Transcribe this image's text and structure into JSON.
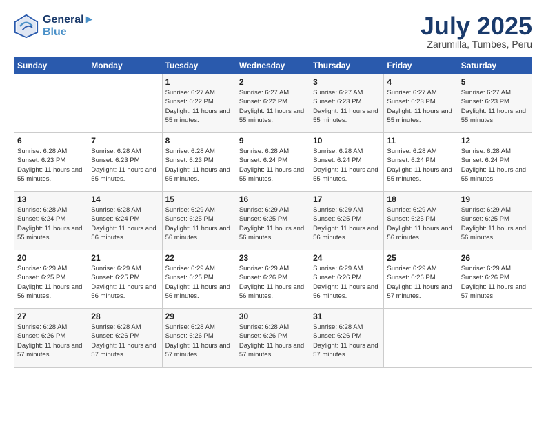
{
  "header": {
    "logo_line1": "General",
    "logo_line2": "Blue",
    "month": "July 2025",
    "location": "Zarumilla, Tumbes, Peru"
  },
  "weekdays": [
    "Sunday",
    "Monday",
    "Tuesday",
    "Wednesday",
    "Thursday",
    "Friday",
    "Saturday"
  ],
  "weeks": [
    [
      {
        "day": "",
        "sunrise": "",
        "sunset": "",
        "daylight": ""
      },
      {
        "day": "",
        "sunrise": "",
        "sunset": "",
        "daylight": ""
      },
      {
        "day": "1",
        "sunrise": "Sunrise: 6:27 AM",
        "sunset": "Sunset: 6:22 PM",
        "daylight": "Daylight: 11 hours and 55 minutes."
      },
      {
        "day": "2",
        "sunrise": "Sunrise: 6:27 AM",
        "sunset": "Sunset: 6:22 PM",
        "daylight": "Daylight: 11 hours and 55 minutes."
      },
      {
        "day": "3",
        "sunrise": "Sunrise: 6:27 AM",
        "sunset": "Sunset: 6:23 PM",
        "daylight": "Daylight: 11 hours and 55 minutes."
      },
      {
        "day": "4",
        "sunrise": "Sunrise: 6:27 AM",
        "sunset": "Sunset: 6:23 PM",
        "daylight": "Daylight: 11 hours and 55 minutes."
      },
      {
        "day": "5",
        "sunrise": "Sunrise: 6:27 AM",
        "sunset": "Sunset: 6:23 PM",
        "daylight": "Daylight: 11 hours and 55 minutes."
      }
    ],
    [
      {
        "day": "6",
        "sunrise": "Sunrise: 6:28 AM",
        "sunset": "Sunset: 6:23 PM",
        "daylight": "Daylight: 11 hours and 55 minutes."
      },
      {
        "day": "7",
        "sunrise": "Sunrise: 6:28 AM",
        "sunset": "Sunset: 6:23 PM",
        "daylight": "Daylight: 11 hours and 55 minutes."
      },
      {
        "day": "8",
        "sunrise": "Sunrise: 6:28 AM",
        "sunset": "Sunset: 6:23 PM",
        "daylight": "Daylight: 11 hours and 55 minutes."
      },
      {
        "day": "9",
        "sunrise": "Sunrise: 6:28 AM",
        "sunset": "Sunset: 6:24 PM",
        "daylight": "Daylight: 11 hours and 55 minutes."
      },
      {
        "day": "10",
        "sunrise": "Sunrise: 6:28 AM",
        "sunset": "Sunset: 6:24 PM",
        "daylight": "Daylight: 11 hours and 55 minutes."
      },
      {
        "day": "11",
        "sunrise": "Sunrise: 6:28 AM",
        "sunset": "Sunset: 6:24 PM",
        "daylight": "Daylight: 11 hours and 55 minutes."
      },
      {
        "day": "12",
        "sunrise": "Sunrise: 6:28 AM",
        "sunset": "Sunset: 6:24 PM",
        "daylight": "Daylight: 11 hours and 55 minutes."
      }
    ],
    [
      {
        "day": "13",
        "sunrise": "Sunrise: 6:28 AM",
        "sunset": "Sunset: 6:24 PM",
        "daylight": "Daylight: 11 hours and 55 minutes."
      },
      {
        "day": "14",
        "sunrise": "Sunrise: 6:28 AM",
        "sunset": "Sunset: 6:24 PM",
        "daylight": "Daylight: 11 hours and 56 minutes."
      },
      {
        "day": "15",
        "sunrise": "Sunrise: 6:29 AM",
        "sunset": "Sunset: 6:25 PM",
        "daylight": "Daylight: 11 hours and 56 minutes."
      },
      {
        "day": "16",
        "sunrise": "Sunrise: 6:29 AM",
        "sunset": "Sunset: 6:25 PM",
        "daylight": "Daylight: 11 hours and 56 minutes."
      },
      {
        "day": "17",
        "sunrise": "Sunrise: 6:29 AM",
        "sunset": "Sunset: 6:25 PM",
        "daylight": "Daylight: 11 hours and 56 minutes."
      },
      {
        "day": "18",
        "sunrise": "Sunrise: 6:29 AM",
        "sunset": "Sunset: 6:25 PM",
        "daylight": "Daylight: 11 hours and 56 minutes."
      },
      {
        "day": "19",
        "sunrise": "Sunrise: 6:29 AM",
        "sunset": "Sunset: 6:25 PM",
        "daylight": "Daylight: 11 hours and 56 minutes."
      }
    ],
    [
      {
        "day": "20",
        "sunrise": "Sunrise: 6:29 AM",
        "sunset": "Sunset: 6:25 PM",
        "daylight": "Daylight: 11 hours and 56 minutes."
      },
      {
        "day": "21",
        "sunrise": "Sunrise: 6:29 AM",
        "sunset": "Sunset: 6:25 PM",
        "daylight": "Daylight: 11 hours and 56 minutes."
      },
      {
        "day": "22",
        "sunrise": "Sunrise: 6:29 AM",
        "sunset": "Sunset: 6:25 PM",
        "daylight": "Daylight: 11 hours and 56 minutes."
      },
      {
        "day": "23",
        "sunrise": "Sunrise: 6:29 AM",
        "sunset": "Sunset: 6:26 PM",
        "daylight": "Daylight: 11 hours and 56 minutes."
      },
      {
        "day": "24",
        "sunrise": "Sunrise: 6:29 AM",
        "sunset": "Sunset: 6:26 PM",
        "daylight": "Daylight: 11 hours and 56 minutes."
      },
      {
        "day": "25",
        "sunrise": "Sunrise: 6:29 AM",
        "sunset": "Sunset: 6:26 PM",
        "daylight": "Daylight: 11 hours and 57 minutes."
      },
      {
        "day": "26",
        "sunrise": "Sunrise: 6:29 AM",
        "sunset": "Sunset: 6:26 PM",
        "daylight": "Daylight: 11 hours and 57 minutes."
      }
    ],
    [
      {
        "day": "27",
        "sunrise": "Sunrise: 6:28 AM",
        "sunset": "Sunset: 6:26 PM",
        "daylight": "Daylight: 11 hours and 57 minutes."
      },
      {
        "day": "28",
        "sunrise": "Sunrise: 6:28 AM",
        "sunset": "Sunset: 6:26 PM",
        "daylight": "Daylight: 11 hours and 57 minutes."
      },
      {
        "day": "29",
        "sunrise": "Sunrise: 6:28 AM",
        "sunset": "Sunset: 6:26 PM",
        "daylight": "Daylight: 11 hours and 57 minutes."
      },
      {
        "day": "30",
        "sunrise": "Sunrise: 6:28 AM",
        "sunset": "Sunset: 6:26 PM",
        "daylight": "Daylight: 11 hours and 57 minutes."
      },
      {
        "day": "31",
        "sunrise": "Sunrise: 6:28 AM",
        "sunset": "Sunset: 6:26 PM",
        "daylight": "Daylight: 11 hours and 57 minutes."
      },
      {
        "day": "",
        "sunrise": "",
        "sunset": "",
        "daylight": ""
      },
      {
        "day": "",
        "sunrise": "",
        "sunset": "",
        "daylight": ""
      }
    ]
  ]
}
